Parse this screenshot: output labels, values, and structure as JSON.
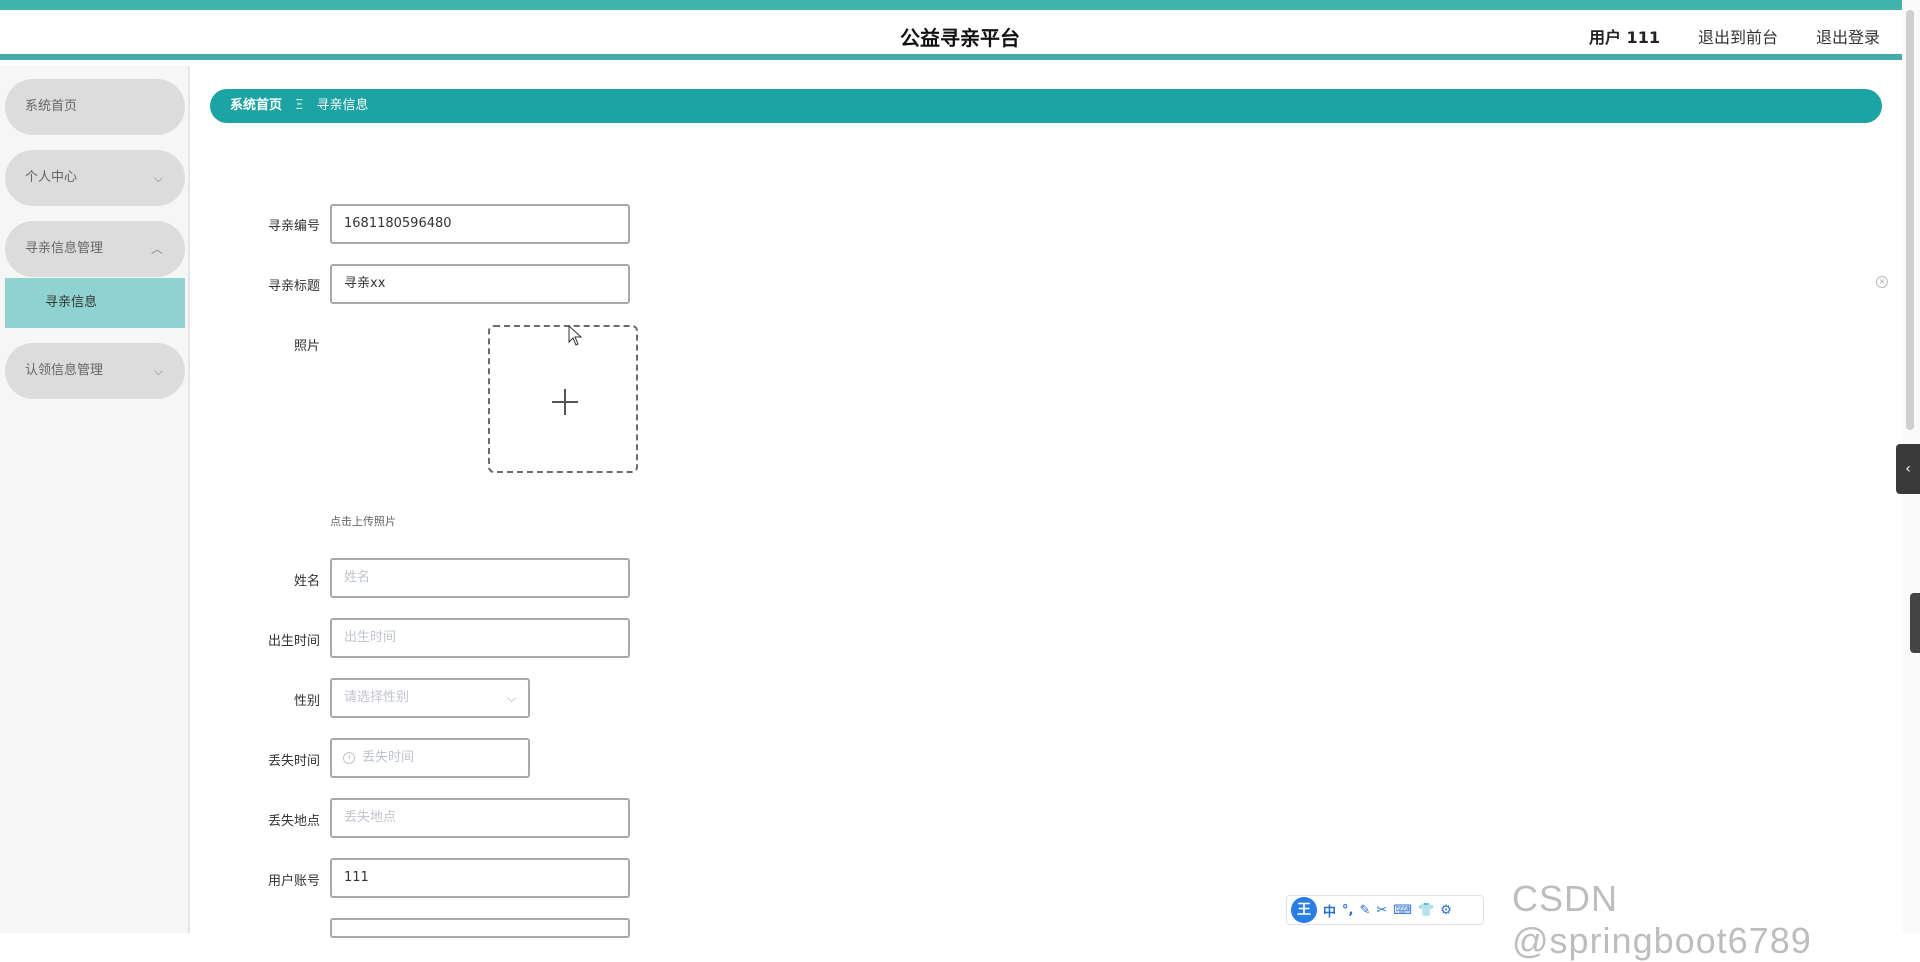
{
  "header": {
    "title": "公益寻亲平台",
    "user": "用户 111",
    "back_to_front": "退出到前台",
    "logout": "退出登录"
  },
  "sidebar": {
    "items": [
      {
        "label": "系统首页"
      },
      {
        "label": "个人中心",
        "chevron": "chevron-down-icon"
      },
      {
        "label": "寻亲信息管理",
        "chevron": "chevron-up-icon"
      },
      {
        "label": "认领信息管理",
        "chevron": "chevron-down-icon"
      }
    ],
    "active_sub": "寻亲信息"
  },
  "breadcrumb": {
    "home": "系统首页",
    "separator": "Ξ",
    "current": "寻亲信息"
  },
  "form": {
    "code_label": "寻亲编号",
    "code_value": "1681180596480",
    "title_label": "寻亲标题",
    "title_value": "寻亲xx",
    "photo_label": "照片",
    "upload_hint": "点击上传照片",
    "name_label": "姓名",
    "name_placeholder": "姓名",
    "birth_label": "出生时间",
    "birth_placeholder": "出生时间",
    "gender_label": "性别",
    "gender_placeholder": "请选择性别",
    "lost_time_label": "丢失时间",
    "lost_time_placeholder": "丢失时间",
    "lost_place_label": "丢失地点",
    "lost_place_placeholder": "丢失地点",
    "account_label": "用户账号",
    "account_value": "111"
  },
  "ime": {
    "logo": "王",
    "items": [
      "中",
      "°,",
      "✎",
      "✂",
      "⌨",
      "👕",
      "⚙"
    ]
  },
  "watermark": "CSDN @springboot6789",
  "colors": {
    "accent": "#1ca3a4",
    "header_line": "#43aca8",
    "active_sub_bg": "#8fd3d0",
    "menu_bg": "#dcdcdc"
  }
}
